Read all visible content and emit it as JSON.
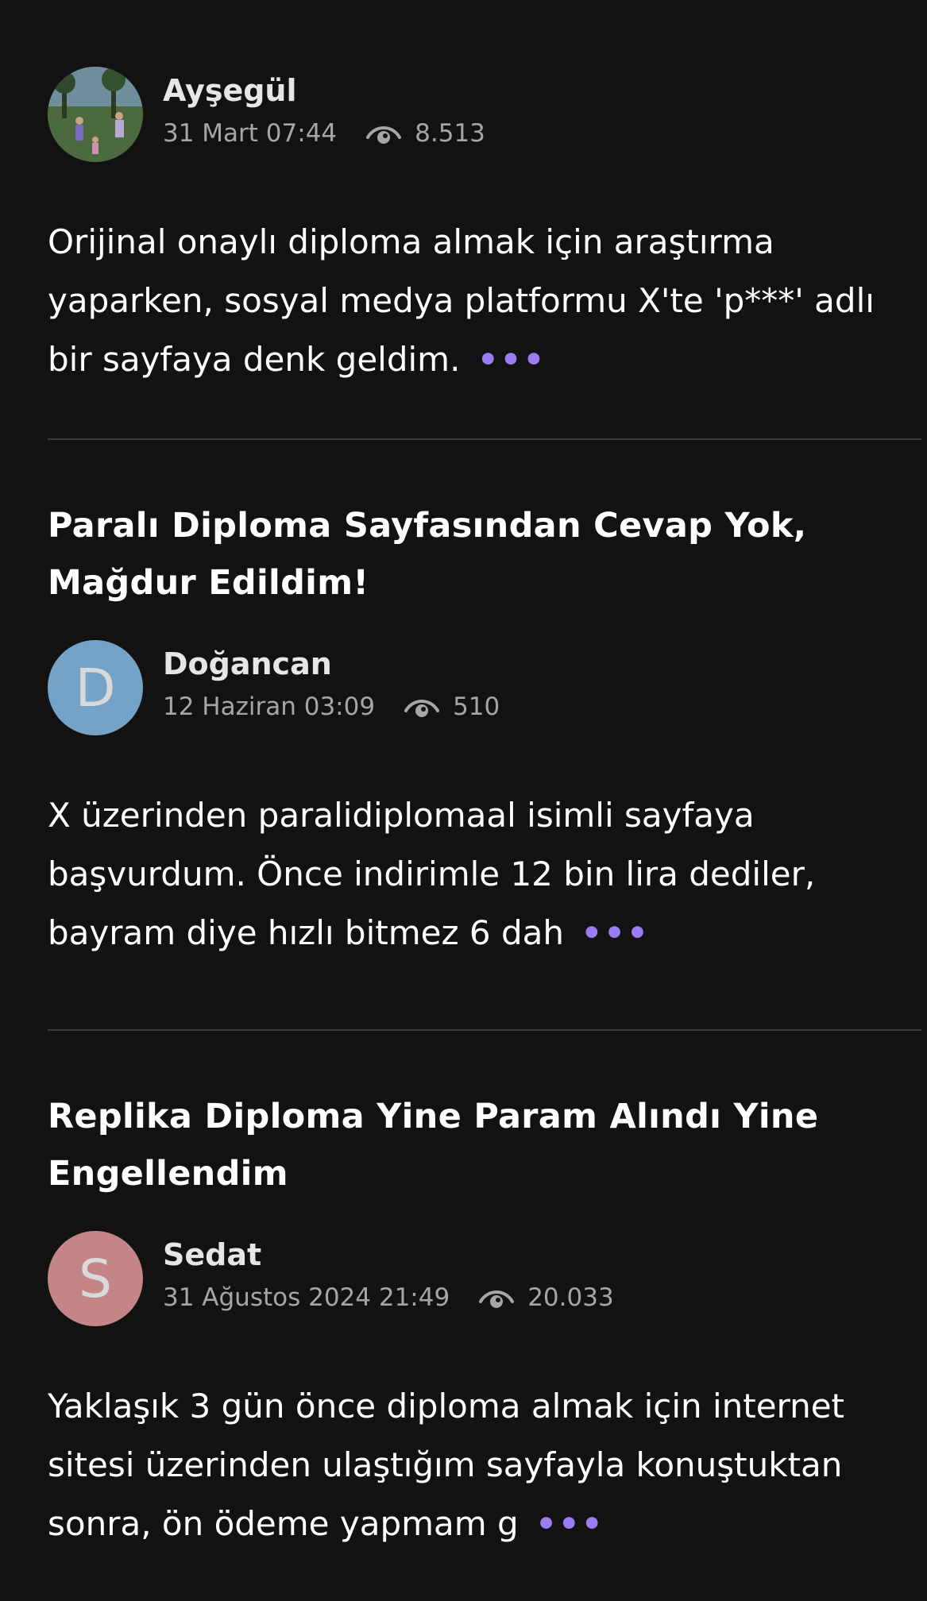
{
  "posts": [
    {
      "author": "Ayşegül",
      "date": "31 Mart 07:44",
      "views": "8.513",
      "body": "Orijinal onaylı diploma almak için araştırma yaparken, sosyal medya platformu X'te 'p***' adlı bir sayfaya denk geldim.",
      "more": "•••",
      "avatar_type": "photo"
    },
    {
      "title": "Paralı Diploma Sayfasından Cevap Yok, Mağdur Edildim!",
      "author": "Doğancan",
      "avatar_letter": "D",
      "avatar_color": "#74a3c7",
      "date": "12 Haziran 03:09",
      "views": "510",
      "body": "X üzerinden paralidiplomaal isimli sayfaya başvurdum. Önce indirimle 12 bin lira dediler, bayram diye hızlı bitmez 6 dah",
      "more": "•••"
    },
    {
      "title": "Replika Diploma Yine Param Alındı Yine Engellendim",
      "author": "Sedat",
      "avatar_letter": "S",
      "avatar_color": "#c48586",
      "date": "31 Ağustos 2024 21:49",
      "views": "20.033",
      "body": "Yaklaşık 3 gün önce diploma almak için internet sitesi üzerinden ulaştığım sayfayla konuştuktan sonra, ön ödeme yapmam g",
      "more": "•••"
    }
  ],
  "colors": {
    "background": "#121212",
    "accent_dots": "#9a7df5",
    "meta_text": "#a6a6a6",
    "divider": "#3a3a3a"
  },
  "icons": {
    "views": "eye-icon"
  }
}
